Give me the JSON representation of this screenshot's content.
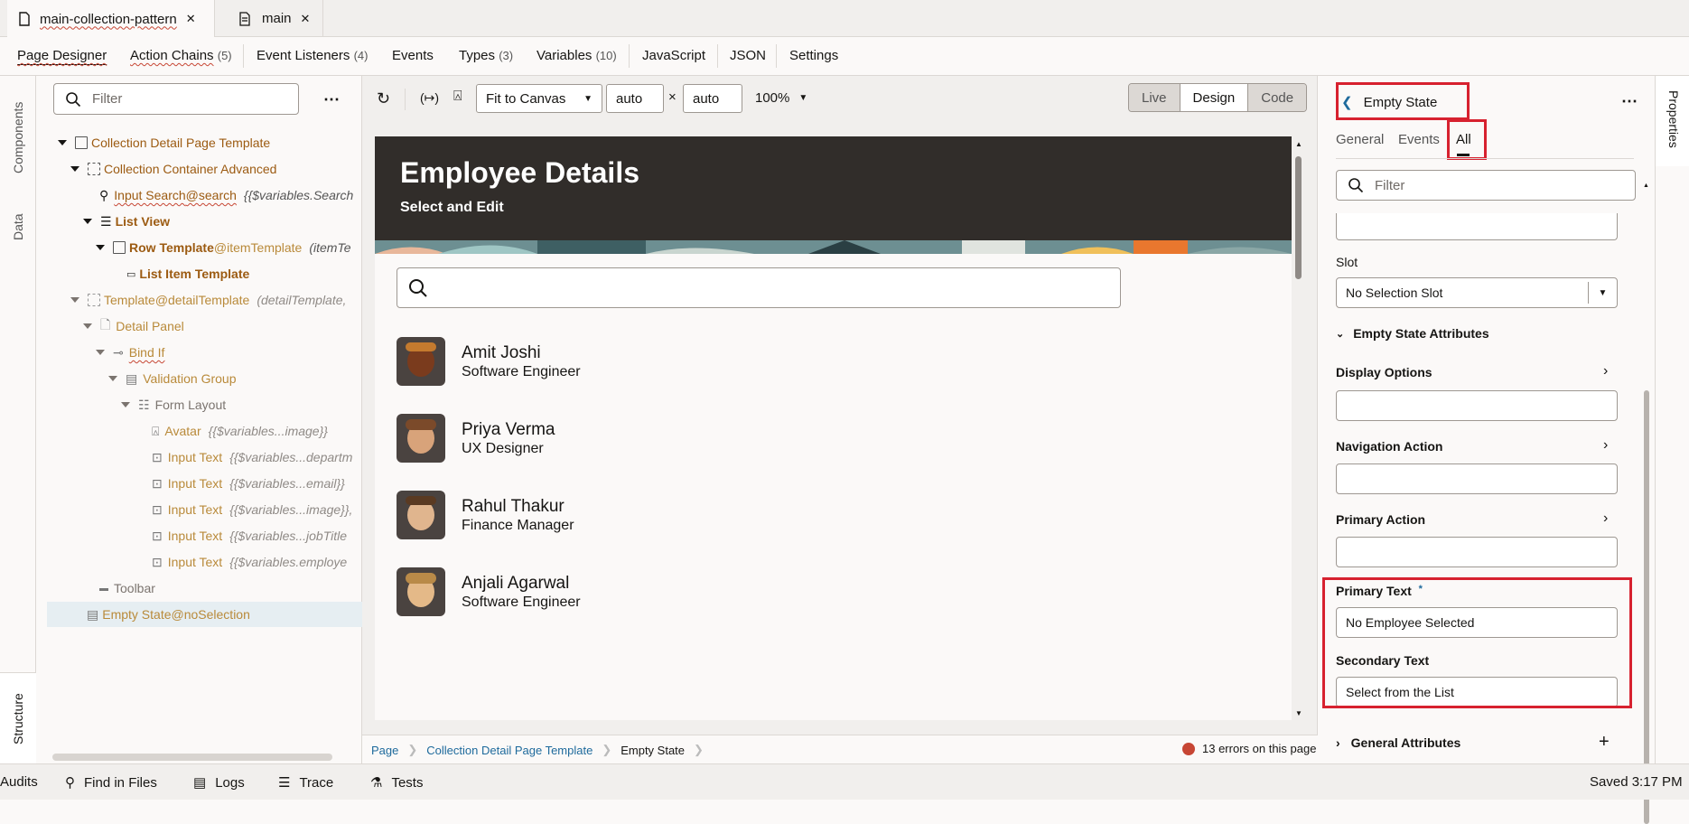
{
  "file_tabs": [
    {
      "label": "main-collection-pattern",
      "icon": "file-icon"
    },
    {
      "label": "main",
      "icon": "document-icon"
    }
  ],
  "nav_tabs": [
    {
      "label": "Page Designer",
      "count": ""
    },
    {
      "label": "Action Chains",
      "count": "(5)"
    },
    {
      "label": "Event Listeners",
      "count": "(4)"
    },
    {
      "label": "Events",
      "count": ""
    },
    {
      "label": "Types",
      "count": "(3)"
    },
    {
      "label": "Variables",
      "count": "(10)"
    },
    {
      "label": "JavaScript",
      "count": ""
    },
    {
      "label": "JSON",
      "count": ""
    },
    {
      "label": "Settings",
      "count": ""
    }
  ],
  "left_strip": {
    "components": "Components",
    "data": "Data",
    "structure": "Structure"
  },
  "structure": {
    "filter_placeholder": "Filter",
    "tree": [
      {
        "label": "Collection Detail Page Template",
        "suffix": "",
        "binding": ""
      },
      {
        "label": "Collection Container Advanced",
        "suffix": "",
        "binding": ""
      },
      {
        "label": "Input Search",
        "suffix": "@search",
        "binding": "{{$variables.Search"
      },
      {
        "label": "List View",
        "suffix": "",
        "binding": ""
      },
      {
        "label": "Row Template",
        "suffix": "@itemTemplate",
        "binding": "(itemTe"
      },
      {
        "label": "List Item Template",
        "suffix": "",
        "binding": ""
      },
      {
        "label": "Template",
        "suffix": "@detailTemplate",
        "binding": "(detailTemplate,"
      },
      {
        "label": "Detail Panel",
        "suffix": "",
        "binding": ""
      },
      {
        "label": "Bind If",
        "suffix": "",
        "binding": ""
      },
      {
        "label": "Validation Group",
        "suffix": "",
        "binding": ""
      },
      {
        "label": "Form Layout",
        "suffix": "",
        "binding": ""
      },
      {
        "label": "Avatar",
        "suffix": "",
        "binding": "{{$variables...image}}"
      },
      {
        "label": "Input Text",
        "suffix": "",
        "binding": "{{$variables...departm"
      },
      {
        "label": "Input Text",
        "suffix": "",
        "binding": "{{$variables...email}}"
      },
      {
        "label": "Input Text",
        "suffix": "",
        "binding": "{{$variables...image}},"
      },
      {
        "label": "Input Text",
        "suffix": "",
        "binding": "{{$variables...jobTitle"
      },
      {
        "label": "Input Text",
        "suffix": "",
        "binding": "{{$variables.employe"
      },
      {
        "label": "Toolbar",
        "suffix": "",
        "binding": ""
      },
      {
        "label": "Empty State",
        "suffix": "@noSelection",
        "binding": ""
      }
    ]
  },
  "canvas_toolbar": {
    "fit": "Fit to Canvas",
    "width": "auto",
    "times": "×",
    "height": "auto",
    "zoom": "100%",
    "modes": [
      "Live",
      "Design",
      "Code"
    ]
  },
  "preview": {
    "title": "Employee Details",
    "subtitle": "Select and Edit",
    "employees": [
      {
        "name": "Amit Joshi",
        "title": "Software Engineer"
      },
      {
        "name": "Priya Verma",
        "title": "UX Designer"
      },
      {
        "name": "Rahul Thakur",
        "title": "Finance Manager"
      },
      {
        "name": "Anjali Agarwal",
        "title": "Software Engineer"
      }
    ]
  },
  "breadcrumbs": [
    "Page",
    "Collection Detail Page Template",
    "Empty State"
  ],
  "errors_text": "13 errors on this page",
  "properties": {
    "title": "Empty State",
    "tabs": [
      "General",
      "Events",
      "All"
    ],
    "filter_placeholder": "Filter",
    "slot_label": "Slot",
    "slot_value": "No Selection Slot",
    "section_label": "Empty State Attributes",
    "display_options": "Display Options",
    "navigation_action": "Navigation Action",
    "primary_action": "Primary Action",
    "primary_text_label": "Primary Text",
    "primary_text_required": "*",
    "primary_text_value": "No Employee Selected",
    "secondary_text_label": "Secondary Text",
    "secondary_text_value": "Select from the List",
    "general_attributes": "General Attributes",
    "side_tab": "Properties"
  },
  "status_bar": {
    "items": [
      "Audits",
      "Find in Files",
      "Logs",
      "Trace",
      "Tests"
    ],
    "saved": "Saved 3:17 PM"
  },
  "colors": {
    "highlight": "#d7212f",
    "hero_bg": "#312d2a",
    "error": "#c74634"
  }
}
